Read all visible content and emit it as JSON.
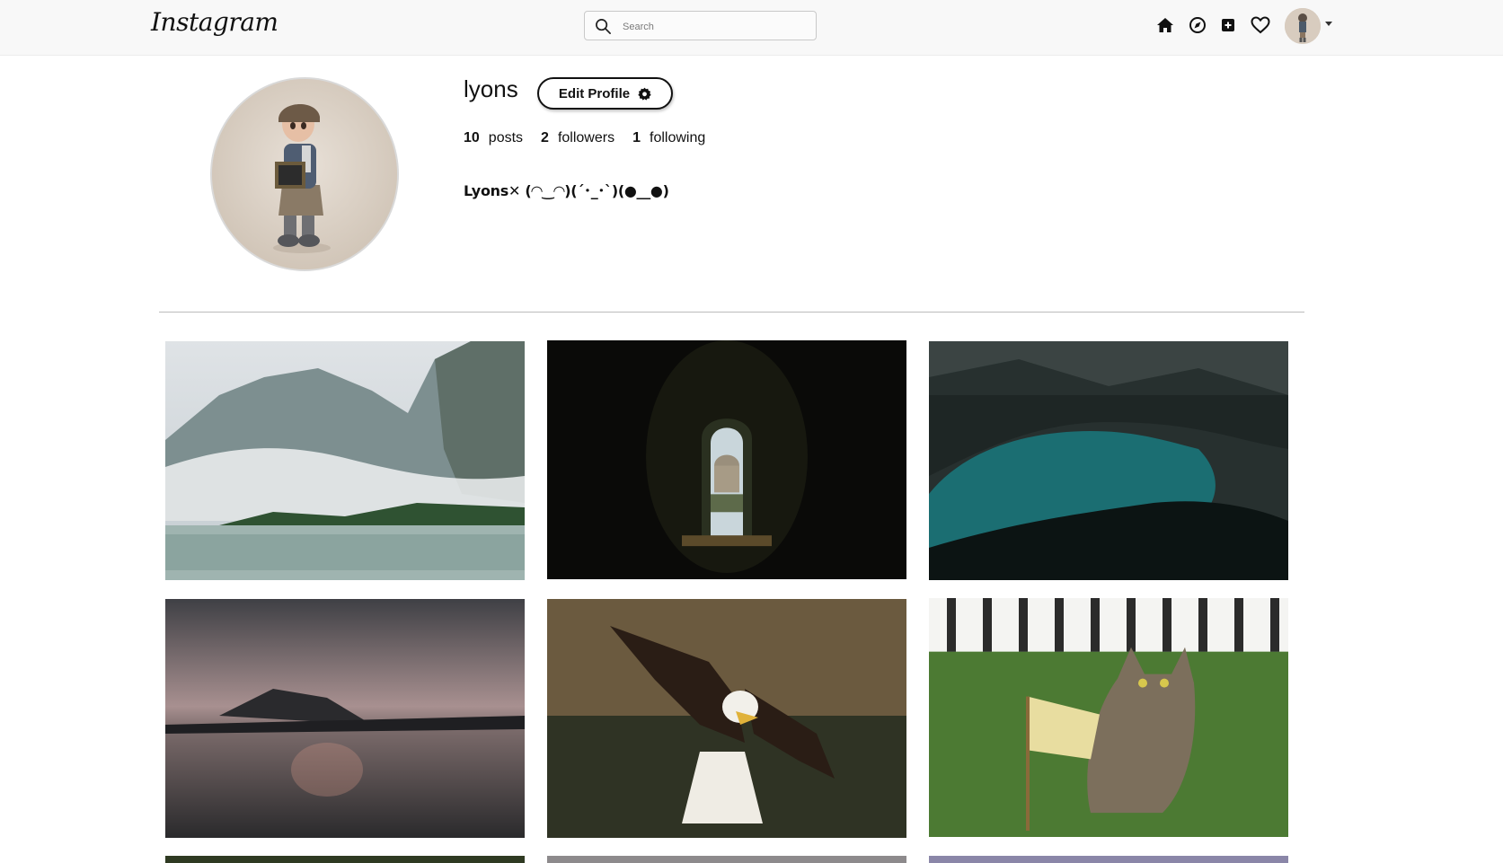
{
  "nav": {
    "logo": "Instagram",
    "search_placeholder": "Search",
    "icons": [
      "home-icon",
      "explore-icon",
      "new-post-icon",
      "activity-heart-icon"
    ]
  },
  "profile": {
    "username": "lyons",
    "edit_button": "Edit Profile",
    "stats": {
      "posts_count": "10",
      "posts_label": "posts",
      "followers_count": "2",
      "followers_label": "followers",
      "following_count": "1",
      "following_label": "following"
    },
    "bio": "Lyons✕ (◠‿◠)(´･_･`)(●__●)"
  },
  "posts": [
    {
      "subject": "misty mountain lake with trees"
    },
    {
      "subject": "keyhole view of domed basilica through dark hedge"
    },
    {
      "subject": "turquoise lake among dark forested mountains"
    },
    {
      "subject": "stadium silhouette on lake at dusk"
    },
    {
      "subject": "bald eagle swooping over water"
    },
    {
      "subject": "tabby cat in grass holding small flag by white fence"
    },
    {
      "subject": "partially visible post"
    },
    {
      "subject": "partially visible post"
    },
    {
      "subject": "partially visible post"
    }
  ],
  "colors": {
    "nav_bg": "#f8f8f8",
    "text": "#111111",
    "divider": "#bcbcbc"
  }
}
